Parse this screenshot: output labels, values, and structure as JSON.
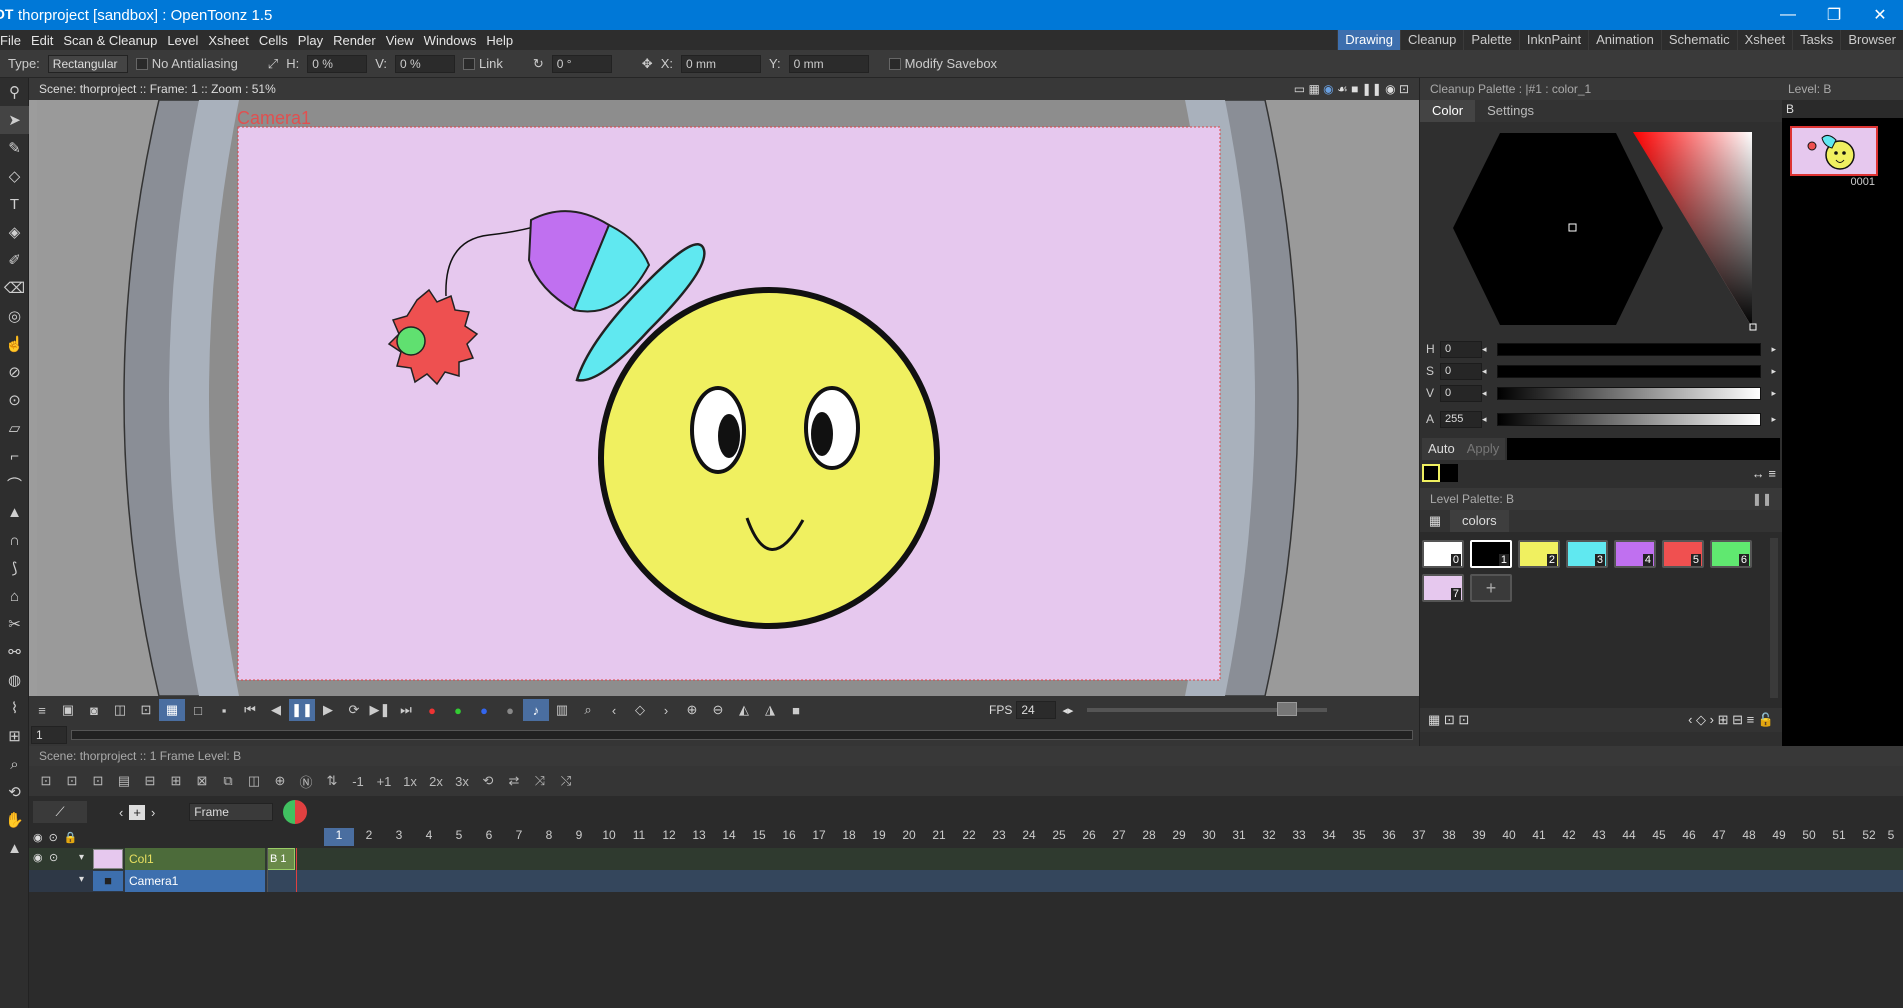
{
  "app": {
    "title": "thorproject [sandbox] : OpenToonz 1.5",
    "logo": "OT"
  },
  "menu": [
    "File",
    "Edit",
    "Scan & Cleanup",
    "Level",
    "Xsheet",
    "Cells",
    "Play",
    "Render",
    "View",
    "Windows",
    "Help"
  ],
  "rooms": [
    {
      "label": "Drawing",
      "active": true
    },
    {
      "label": "Cleanup"
    },
    {
      "label": "Palette"
    },
    {
      "label": "InknPaint"
    },
    {
      "label": "Animation"
    },
    {
      "label": "Schematic"
    },
    {
      "label": "Xsheet"
    },
    {
      "label": "Tasks"
    },
    {
      "label": "Browser"
    }
  ],
  "tool_options": {
    "type_label": "Type:",
    "type_value": "Rectangular",
    "antialias": "No Antialiasing",
    "h_label": "H:",
    "h_val": "0 %",
    "v_label": "V:",
    "v_val": "0 %",
    "link": "Link",
    "rot_val": "0 °",
    "x_label": "X:",
    "x_val": "0 mm",
    "y_label": "Y:",
    "y_val": "0 mm",
    "modify": "Modify Savebox"
  },
  "viewer": {
    "header": "Scene: thorproject  ::  Frame: 1  ::  Zoom : 51%",
    "camera_label": "Camera1",
    "fps_label": "FPS",
    "fps": "24",
    "frame": "1"
  },
  "palette": {
    "header": "Cleanup Palette : |#1 : color_1",
    "tab_color": "Color",
    "tab_settings": "Settings",
    "h": "0",
    "s": "0",
    "v": "0",
    "a": "255",
    "auto": "Auto",
    "apply": "Apply",
    "level_palette": "Level Palette: B",
    "page": "colors",
    "chips": [
      {
        "n": "0",
        "c": "#ffffff"
      },
      {
        "n": "1",
        "c": "#000000"
      },
      {
        "n": "2",
        "c": "#f0f060"
      },
      {
        "n": "3",
        "c": "#60e8f0"
      },
      {
        "n": "4",
        "c": "#c070f0"
      },
      {
        "n": "5",
        "c": "#f05050"
      },
      {
        "n": "6",
        "c": "#60e870"
      },
      {
        "n": "7",
        "c": "#e6c8ee"
      }
    ]
  },
  "level_strip": {
    "header": "Level:  B",
    "name": "B",
    "frame": "0001"
  },
  "xsheet": {
    "header": "Scene: thorproject  ::  1 Frame  Level: B",
    "frame_mode": "Frame",
    "col1": "Col1",
    "camera": "Camera1",
    "cell": "B  1",
    "frames": [
      "1",
      "2",
      "3",
      "4",
      "5",
      "6",
      "7",
      "8",
      "9",
      "10",
      "11",
      "12",
      "13",
      "14",
      "15",
      "16",
      "17",
      "18",
      "19",
      "20",
      "21",
      "22",
      "23",
      "24",
      "25",
      "26",
      "27",
      "28",
      "29",
      "30",
      "31",
      "32",
      "33",
      "34",
      "35",
      "36",
      "37",
      "38",
      "39",
      "40",
      "41",
      "42",
      "43",
      "44",
      "45",
      "46",
      "47",
      "48",
      "49",
      "50",
      "51",
      "52",
      "5"
    ]
  }
}
